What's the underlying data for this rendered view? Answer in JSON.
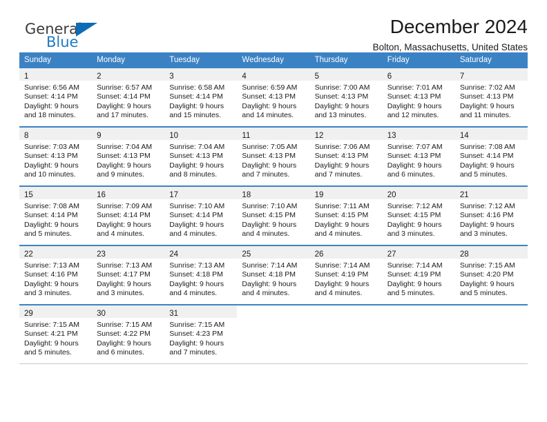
{
  "brand": {
    "word1": "General",
    "word2": "Blue",
    "triangle_color": "#0f6bb5",
    "word1_color": "#3b3b3b",
    "word2_color": "#1f7bc1"
  },
  "header": {
    "title": "December 2024",
    "subtitle": "Bolton, Massachusetts, United States"
  },
  "theme": {
    "header_blue": "#3b82c4",
    "daynum_band": "#f0f0f0",
    "cell_border": "#c8c8c8"
  },
  "weekdays": [
    "Sunday",
    "Monday",
    "Tuesday",
    "Wednesday",
    "Thursday",
    "Friday",
    "Saturday"
  ],
  "weeks": [
    [
      {
        "day": "1",
        "lines": [
          "Sunrise: 6:56 AM",
          "Sunset: 4:14 PM",
          "Daylight: 9 hours",
          "and 18 minutes."
        ]
      },
      {
        "day": "2",
        "lines": [
          "Sunrise: 6:57 AM",
          "Sunset: 4:14 PM",
          "Daylight: 9 hours",
          "and 17 minutes."
        ]
      },
      {
        "day": "3",
        "lines": [
          "Sunrise: 6:58 AM",
          "Sunset: 4:14 PM",
          "Daylight: 9 hours",
          "and 15 minutes."
        ]
      },
      {
        "day": "4",
        "lines": [
          "Sunrise: 6:59 AM",
          "Sunset: 4:13 PM",
          "Daylight: 9 hours",
          "and 14 minutes."
        ]
      },
      {
        "day": "5",
        "lines": [
          "Sunrise: 7:00 AM",
          "Sunset: 4:13 PM",
          "Daylight: 9 hours",
          "and 13 minutes."
        ]
      },
      {
        "day": "6",
        "lines": [
          "Sunrise: 7:01 AM",
          "Sunset: 4:13 PM",
          "Daylight: 9 hours",
          "and 12 minutes."
        ]
      },
      {
        "day": "7",
        "lines": [
          "Sunrise: 7:02 AM",
          "Sunset: 4:13 PM",
          "Daylight: 9 hours",
          "and 11 minutes."
        ]
      }
    ],
    [
      {
        "day": "8",
        "lines": [
          "Sunrise: 7:03 AM",
          "Sunset: 4:13 PM",
          "Daylight: 9 hours",
          "and 10 minutes."
        ]
      },
      {
        "day": "9",
        "lines": [
          "Sunrise: 7:04 AM",
          "Sunset: 4:13 PM",
          "Daylight: 9 hours",
          "and 9 minutes."
        ]
      },
      {
        "day": "10",
        "lines": [
          "Sunrise: 7:04 AM",
          "Sunset: 4:13 PM",
          "Daylight: 9 hours",
          "and 8 minutes."
        ]
      },
      {
        "day": "11",
        "lines": [
          "Sunrise: 7:05 AM",
          "Sunset: 4:13 PM",
          "Daylight: 9 hours",
          "and 7 minutes."
        ]
      },
      {
        "day": "12",
        "lines": [
          "Sunrise: 7:06 AM",
          "Sunset: 4:13 PM",
          "Daylight: 9 hours",
          "and 7 minutes."
        ]
      },
      {
        "day": "13",
        "lines": [
          "Sunrise: 7:07 AM",
          "Sunset: 4:13 PM",
          "Daylight: 9 hours",
          "and 6 minutes."
        ]
      },
      {
        "day": "14",
        "lines": [
          "Sunrise: 7:08 AM",
          "Sunset: 4:14 PM",
          "Daylight: 9 hours",
          "and 5 minutes."
        ]
      }
    ],
    [
      {
        "day": "15",
        "lines": [
          "Sunrise: 7:08 AM",
          "Sunset: 4:14 PM",
          "Daylight: 9 hours",
          "and 5 minutes."
        ]
      },
      {
        "day": "16",
        "lines": [
          "Sunrise: 7:09 AM",
          "Sunset: 4:14 PM",
          "Daylight: 9 hours",
          "and 4 minutes."
        ]
      },
      {
        "day": "17",
        "lines": [
          "Sunrise: 7:10 AM",
          "Sunset: 4:14 PM",
          "Daylight: 9 hours",
          "and 4 minutes."
        ]
      },
      {
        "day": "18",
        "lines": [
          "Sunrise: 7:10 AM",
          "Sunset: 4:15 PM",
          "Daylight: 9 hours",
          "and 4 minutes."
        ]
      },
      {
        "day": "19",
        "lines": [
          "Sunrise: 7:11 AM",
          "Sunset: 4:15 PM",
          "Daylight: 9 hours",
          "and 4 minutes."
        ]
      },
      {
        "day": "20",
        "lines": [
          "Sunrise: 7:12 AM",
          "Sunset: 4:15 PM",
          "Daylight: 9 hours",
          "and 3 minutes."
        ]
      },
      {
        "day": "21",
        "lines": [
          "Sunrise: 7:12 AM",
          "Sunset: 4:16 PM",
          "Daylight: 9 hours",
          "and 3 minutes."
        ]
      }
    ],
    [
      {
        "day": "22",
        "lines": [
          "Sunrise: 7:13 AM",
          "Sunset: 4:16 PM",
          "Daylight: 9 hours",
          "and 3 minutes."
        ]
      },
      {
        "day": "23",
        "lines": [
          "Sunrise: 7:13 AM",
          "Sunset: 4:17 PM",
          "Daylight: 9 hours",
          "and 3 minutes."
        ]
      },
      {
        "day": "24",
        "lines": [
          "Sunrise: 7:13 AM",
          "Sunset: 4:18 PM",
          "Daylight: 9 hours",
          "and 4 minutes."
        ]
      },
      {
        "day": "25",
        "lines": [
          "Sunrise: 7:14 AM",
          "Sunset: 4:18 PM",
          "Daylight: 9 hours",
          "and 4 minutes."
        ]
      },
      {
        "day": "26",
        "lines": [
          "Sunrise: 7:14 AM",
          "Sunset: 4:19 PM",
          "Daylight: 9 hours",
          "and 4 minutes."
        ]
      },
      {
        "day": "27",
        "lines": [
          "Sunrise: 7:14 AM",
          "Sunset: 4:19 PM",
          "Daylight: 9 hours",
          "and 5 minutes."
        ]
      },
      {
        "day": "28",
        "lines": [
          "Sunrise: 7:15 AM",
          "Sunset: 4:20 PM",
          "Daylight: 9 hours",
          "and 5 minutes."
        ]
      }
    ],
    [
      {
        "day": "29",
        "lines": [
          "Sunrise: 7:15 AM",
          "Sunset: 4:21 PM",
          "Daylight: 9 hours",
          "and 5 minutes."
        ]
      },
      {
        "day": "30",
        "lines": [
          "Sunrise: 7:15 AM",
          "Sunset: 4:22 PM",
          "Daylight: 9 hours",
          "and 6 minutes."
        ]
      },
      {
        "day": "31",
        "lines": [
          "Sunrise: 7:15 AM",
          "Sunset: 4:23 PM",
          "Daylight: 9 hours",
          "and 7 minutes."
        ]
      },
      {
        "day": "",
        "lines": []
      },
      {
        "day": "",
        "lines": []
      },
      {
        "day": "",
        "lines": []
      },
      {
        "day": "",
        "lines": []
      }
    ]
  ]
}
